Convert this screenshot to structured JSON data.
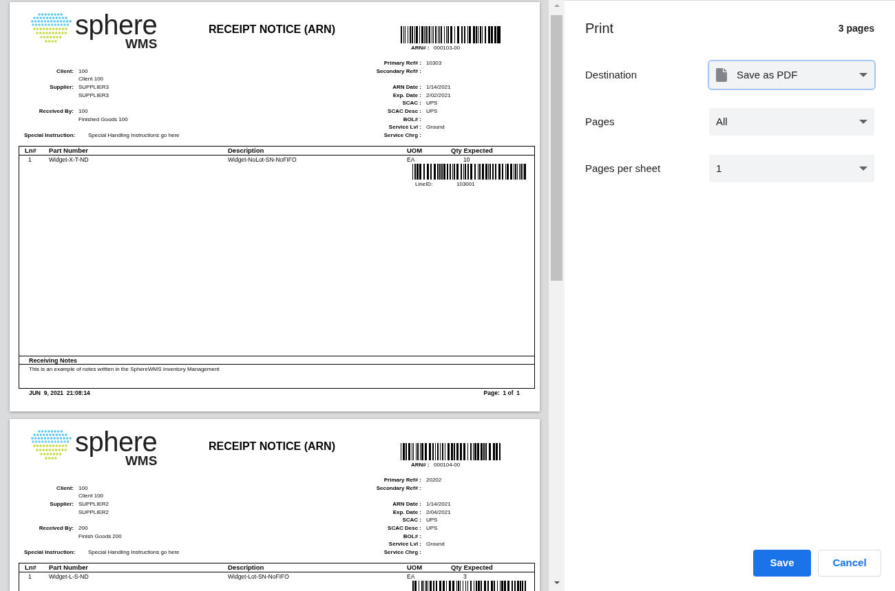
{
  "preview": {
    "pages": [
      {
        "logo": {
          "wordmark": "sphere",
          "suffix": "WMS"
        },
        "title": "RECEIPT NOTICE (ARN)",
        "arn": {
          "label": "ARN# :",
          "value": "000103-00"
        },
        "left_groups": [
          {
            "fields": [
              {
                "label": "Client:",
                "values": [
                  "100",
                  "Client 100"
                ]
              },
              {
                "label": "Supplier:",
                "values": [
                  "SUPPLIER3",
                  "SUPPLIER3"
                ]
              }
            ]
          },
          {
            "fields": [
              {
                "label": "Received By:",
                "values": [
                  "100",
                  "Finished Goods 100"
                ]
              }
            ]
          }
        ],
        "special_instruction": {
          "label": "Special Instruction:",
          "value": "Special Handling Instructions go here"
        },
        "right_groups": [
          {
            "fields": [
              {
                "label": "Primary Ref# :",
                "value": "10303"
              },
              {
                "label": "Secondary Ref# :"
              }
            ]
          },
          {
            "fields": [
              {
                "label": "ARN Date :",
                "value": "1/14/2021"
              },
              {
                "label": "Exp. Date :",
                "value": "2/02/2021"
              },
              {
                "label": "SCAC :",
                "value": "UPS"
              },
              {
                "label": "SCAC Desc :",
                "value": "UPS"
              },
              {
                "label": "BOL# :"
              },
              {
                "label": "Service Lvl :",
                "value": "Ground"
              },
              {
                "label": "Service Chrg :"
              }
            ]
          }
        ],
        "table": {
          "columns": [
            "Ln#",
            "Part Number",
            "Description",
            "UOM",
            "Qty Expected"
          ],
          "rows": [
            {
              "cells": [
                "1",
                "Widget-X-T-ND",
                "Widget-NoLot-SN-NoFIFO",
                "EA",
                "10"
              ],
              "line_id": {
                "label": "LineID:",
                "value": "103001"
              }
            }
          ]
        },
        "receiving_notes": {
          "title": "Receiving Notes",
          "text": "This is an example of notes written in the SphereWMS Inventory Management"
        },
        "footer": {
          "printed_at": "JUN  9, 2021  21:08:14",
          "page_number": "Page:  1 of  1"
        }
      },
      {
        "logo": {
          "wordmark": "sphere",
          "suffix": "WMS"
        },
        "title": "RECEIPT NOTICE (ARN)",
        "arn": {
          "label": "ARN# :",
          "value": "000104-00"
        },
        "left_groups": [
          {
            "fields": [
              {
                "label": "Client:",
                "values": [
                  "100",
                  "Client 100"
                ]
              },
              {
                "label": "Supplier:",
                "values": [
                  "SUPPLIER2",
                  "SUPPLIER2"
                ]
              }
            ]
          },
          {
            "fields": [
              {
                "label": "Received By:",
                "values": [
                  "200",
                  "Finish Goods 200"
                ]
              }
            ]
          }
        ],
        "special_instruction": {
          "label": "Special Instruction:",
          "value": "Special Handling Instructions go here"
        },
        "right_groups": [
          {
            "fields": [
              {
                "label": "Primary Ref# :",
                "value": "20202"
              },
              {
                "label": "Secondary Ref# :"
              }
            ]
          },
          {
            "fields": [
              {
                "label": "ARN Date :",
                "value": "1/14/2021"
              },
              {
                "label": "Exp. Date :",
                "value": "2/04/2021"
              },
              {
                "label": "SCAC :",
                "value": "UPS"
              },
              {
                "label": "SCAC Desc :",
                "value": "UPS"
              },
              {
                "label": "BOL# :"
              },
              {
                "label": "Service Lvl :",
                "value": "Ground"
              },
              {
                "label": "Service Chrg :"
              }
            ]
          }
        ],
        "table": {
          "columns": [
            "Ln#",
            "Part Number",
            "Description",
            "UOM",
            "Qty Expected"
          ],
          "rows": [
            {
              "cells": [
                "1",
                "Widget-L-S-ND",
                "Widget-Lot-SN-NoFIFO",
                "EA",
                "3"
              ]
            }
          ]
        }
      }
    ]
  },
  "print_panel": {
    "title": "Print",
    "page_count": "3 pages",
    "settings": [
      {
        "kind": "destination",
        "label": "Destination",
        "value": "Save as PDF",
        "focused": true
      },
      {
        "kind": "dropdown",
        "label": "Pages",
        "value": "All",
        "focused": false
      },
      {
        "kind": "dropdown",
        "label": "Pages per sheet",
        "value": "1",
        "focused": false
      }
    ],
    "buttons": [
      {
        "kind": "primary",
        "label": "Save"
      },
      {
        "kind": "secondary",
        "label": "Cancel"
      }
    ]
  }
}
